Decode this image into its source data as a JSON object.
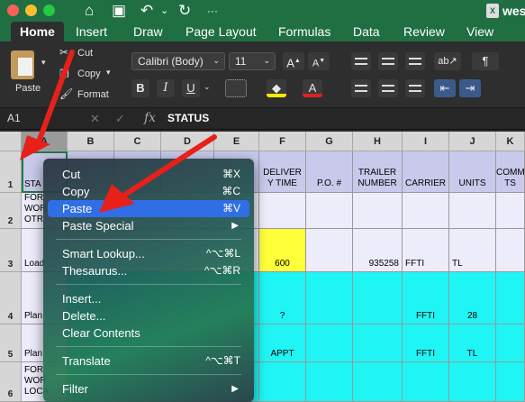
{
  "window": {
    "title": "west",
    "toolbar_icons": [
      "home-icon",
      "save-icon",
      "undo-icon",
      "redo-icon"
    ]
  },
  "ribbon_tabs": [
    "Home",
    "Insert",
    "Draw",
    "Page Layout",
    "Formulas",
    "Data",
    "Review",
    "View"
  ],
  "ribbon": {
    "paste_label": "Paste",
    "cut_label": "Cut",
    "copy_label": "Copy",
    "format_label": "Format",
    "font_name": "Calibri (Body)",
    "font_size": "11",
    "bold": "B",
    "italic": "I",
    "underline": "U"
  },
  "formula_bar": {
    "name_box": "A1",
    "fx_label": "fx",
    "value": "STATUS"
  },
  "columns": [
    "A",
    "B",
    "C",
    "D",
    "E",
    "F",
    "G",
    "H",
    "I",
    "J",
    "K"
  ],
  "rows": [
    "1",
    "2",
    "3",
    "4",
    "5",
    "6"
  ],
  "header_row": {
    "A": "STA",
    "F": "DELIVER Y TIME",
    "G": "P.O. #",
    "H": "TRAILER NUMBER",
    "I": "CARRIER",
    "J": "UNITS",
    "K": "COMM TS"
  },
  "cells": {
    "A2": "FOR WOR OTR",
    "A3": "Load",
    "A4": "Plan",
    "A5": "Plan",
    "A6": "FOR WOR LOCA",
    "F3": "600",
    "H3": "935258",
    "I3": "FFTI",
    "J3": "TL",
    "F4": "?",
    "I4": "FFTI",
    "J4": "28",
    "F5": "APPT",
    "I5": "FFTI",
    "J5": "TL"
  },
  "context_menu": {
    "items": [
      {
        "label": "Cut",
        "shortcut": "⌘X"
      },
      {
        "label": "Copy",
        "shortcut": "⌘C"
      },
      {
        "label": "Paste",
        "shortcut": "⌘V"
      },
      {
        "label": "Paste Special",
        "shortcut": ""
      },
      {
        "label": "Smart Lookup...",
        "shortcut": "^⌥⌘L"
      },
      {
        "label": "Thesaurus...",
        "shortcut": "^⌥⌘R"
      },
      {
        "label": "Insert...",
        "shortcut": ""
      },
      {
        "label": "Delete...",
        "shortcut": ""
      },
      {
        "label": "Clear Contents",
        "shortcut": ""
      },
      {
        "label": "Translate",
        "shortcut": "^⌥⌘T"
      },
      {
        "label": "Filter",
        "shortcut": ""
      }
    ]
  },
  "colors": {
    "ribbon_green": "#1f6f43",
    "header_fill": "#c9c9ec",
    "cyan_fill": "#1ff5f5",
    "yellow_fill": "#ffff3a",
    "menu_highlight": "#2f6ee5",
    "annotation_arrow": "#e8201a"
  }
}
